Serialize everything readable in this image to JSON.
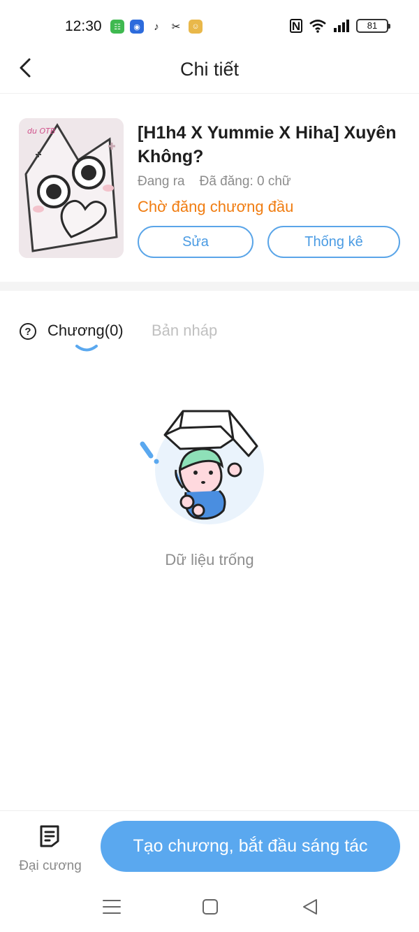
{
  "status_bar": {
    "time": "12:30",
    "nfc": "N",
    "battery": "81"
  },
  "header": {
    "title": "Chi tiết"
  },
  "book": {
    "title": "[H1h4 X Yummie X Hiha] Xuyên Không?",
    "status": "Đang ra",
    "published": "Đã đăng: 0 chữ",
    "state": "Chờ đăng chương đầu",
    "edit_label": "Sửa",
    "stats_label": "Thống kê",
    "cover_tag": "du OTB"
  },
  "tabs": {
    "help": "?",
    "chapters_label": "Chương(0)",
    "drafts_label": "Bản nháp"
  },
  "empty": {
    "text": "Dữ liệu trống"
  },
  "bottom": {
    "outline_label": "Đại cương",
    "create_label": "Tạo chương, bắt đầu sáng tác"
  },
  "colors": {
    "accent": "#5aa8ef",
    "warning": "#f07c10"
  }
}
